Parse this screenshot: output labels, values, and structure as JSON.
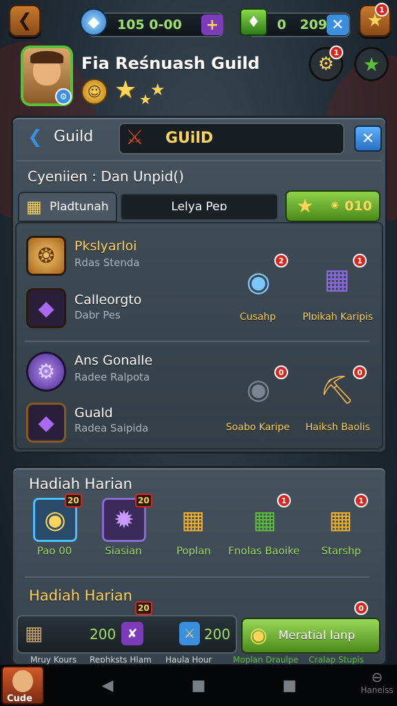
{
  "top_bar": {
    "back_icon": "arrow-left-icon",
    "gems_value": "105 0-00",
    "gold_value": "0   209",
    "star_badge": "1"
  },
  "guild_header": {
    "guild_name": "Fia Reśnuash Guild",
    "alert_badge": "1"
  },
  "panel_header": {
    "back_label": "Guild",
    "tab_label": "GUilD"
  },
  "subtitle": "Cyeniien : Dan Unpid()",
  "tabs": [
    {
      "label": "Pladtunah"
    },
    {
      "label": "Lelya Peɒ"
    }
  ],
  "green_button": {
    "value": "010"
  },
  "members": [
    {
      "name": "Pkslyarloi",
      "sub": "Rdas Stenda",
      "highlight": true
    },
    {
      "name": "Calleorgto",
      "sub": "Dabr Pes",
      "highlight": false
    },
    {
      "name": "Ans Gonalle",
      "sub": "Radee Ralpota",
      "highlight": false
    },
    {
      "name": "Guald",
      "sub": "Radea Saipida",
      "highlight": false
    }
  ],
  "rewards": [
    {
      "label": "Cusahp",
      "badge": "2"
    },
    {
      "label": "Plɒikah Karipis",
      "badge": "1"
    },
    {
      "label": "Soabo Karipe",
      "badge": "0"
    },
    {
      "label": "Haiksh Baolis",
      "badge": "0"
    }
  ],
  "daily": {
    "title": "Hadiah Harian",
    "items": [
      {
        "label": "Pao 00",
        "badge": "20"
      },
      {
        "label": "Siasian",
        "badge": "20"
      },
      {
        "label": "Poplan",
        "badge": ""
      },
      {
        "label": "Fnolas Baoike",
        "badge": "1"
      },
      {
        "label": "Starshp",
        "badge": "1"
      }
    ],
    "title2": "Hadiah Harian",
    "row2_badges": [
      "20",
      "0"
    ]
  },
  "bottom_bar": {
    "value1": "200",
    "value2": "200",
    "action_label": "Meratial lanp",
    "labels": [
      "Mruy Kours",
      "Reɒhksts Hlam",
      "Haula Hour",
      "Moplan Draulpe",
      "Cralap Stupis"
    ]
  },
  "navbar": {
    "profile_label": "Cude",
    "right_label": "Haneiss"
  },
  "colors": {
    "accent_gold": "#ffd45a",
    "accent_green": "#9fe06a",
    "accent_blue": "#3b8fe0",
    "badge_red": "#d7261d"
  }
}
